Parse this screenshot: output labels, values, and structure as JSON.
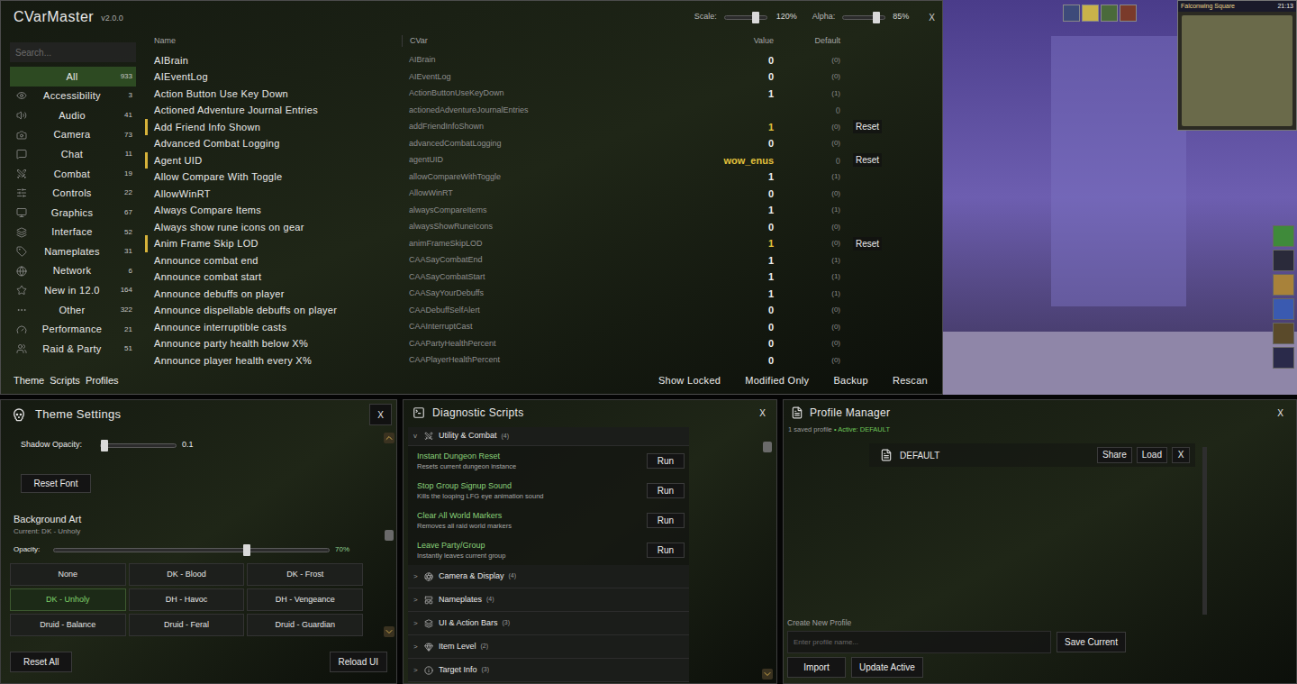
{
  "main": {
    "title": "CVarMaster",
    "version": "v2.0.0",
    "scale": {
      "label": "Scale:",
      "level": 0.75,
      "reading": "120%"
    },
    "alpha": {
      "label": "Alpha:",
      "level": 0.8,
      "reading": "85%"
    },
    "close": "X",
    "search": {
      "placeholder": "Search..."
    },
    "categories": [
      {
        "label": "All",
        "count": "933",
        "selected": true
      },
      {
        "label": "Accessibility",
        "count": "3",
        "selected": false
      },
      {
        "label": "Audio",
        "count": "41",
        "selected": false
      },
      {
        "label": "Camera",
        "count": "73",
        "selected": false
      },
      {
        "label": "Chat",
        "count": "11",
        "selected": false
      },
      {
        "label": "Combat",
        "count": "19",
        "selected": false
      },
      {
        "label": "Controls",
        "count": "22",
        "selected": false
      },
      {
        "label": "Graphics",
        "count": "67",
        "selected": false
      },
      {
        "label": "Interface",
        "count": "52",
        "selected": false
      },
      {
        "label": "Nameplates",
        "count": "31",
        "selected": false
      },
      {
        "label": "Network",
        "count": "6",
        "selected": false
      },
      {
        "label": "New in 12.0",
        "count": "164",
        "selected": false
      },
      {
        "label": "Other",
        "count": "322",
        "selected": false
      },
      {
        "label": "Performance",
        "count": "21",
        "selected": false
      },
      {
        "label": "Raid & Party",
        "count": "51",
        "selected": false
      }
    ],
    "columns": [
      "Name",
      "CVar",
      "Value",
      "Default"
    ],
    "rows": [
      {
        "name": "AIBrain",
        "cvar": "AIBrain",
        "value": "0",
        "default": "(0)",
        "modified": false,
        "reset": ""
      },
      {
        "name": "AIEventLog",
        "cvar": "AIEventLog",
        "value": "0",
        "default": "(0)",
        "modified": false,
        "reset": ""
      },
      {
        "name": "Action Button Use Key Down",
        "cvar": "ActionButtonUseKeyDown",
        "value": "1",
        "default": "(1)",
        "modified": false,
        "reset": ""
      },
      {
        "name": "Actioned Adventure Journal Entries",
        "cvar": "actionedAdventureJournalEntries",
        "value": "",
        "default": "()",
        "modified": false,
        "reset": ""
      },
      {
        "name": "Add Friend Info Shown",
        "cvar": "addFriendInfoShown",
        "value": "1",
        "default": "(0)",
        "modified": true,
        "reset": "Reset"
      },
      {
        "name": "Advanced Combat Logging",
        "cvar": "advancedCombatLogging",
        "value": "0",
        "default": "(0)",
        "modified": false,
        "reset": ""
      },
      {
        "name": "Agent UID",
        "cvar": "agentUID",
        "value": "wow_enus",
        "default": "()",
        "modified": true,
        "reset": "Reset"
      },
      {
        "name": "Allow Compare With Toggle",
        "cvar": "allowCompareWithToggle",
        "value": "1",
        "default": "(1)",
        "modified": false,
        "reset": ""
      },
      {
        "name": "AllowWinRT",
        "cvar": "AllowWinRT",
        "value": "0",
        "default": "(0)",
        "modified": false,
        "reset": ""
      },
      {
        "name": "Always Compare Items",
        "cvar": "alwaysCompareItems",
        "value": "1",
        "default": "(1)",
        "modified": false,
        "reset": ""
      },
      {
        "name": "Always show rune icons on gear",
        "cvar": "alwaysShowRuneIcons",
        "value": "0",
        "default": "(0)",
        "modified": false,
        "reset": ""
      },
      {
        "name": "Anim Frame Skip LOD",
        "cvar": "animFrameSkipLOD",
        "value": "1",
        "default": "(0)",
        "modified": true,
        "reset": "Reset"
      },
      {
        "name": "Announce combat end",
        "cvar": "CAASayCombatEnd",
        "value": "1",
        "default": "(1)",
        "modified": false,
        "reset": ""
      },
      {
        "name": "Announce combat start",
        "cvar": "CAASayCombatStart",
        "value": "1",
        "default": "(1)",
        "modified": false,
        "reset": ""
      },
      {
        "name": "Announce debuffs on player",
        "cvar": "CAASayYourDebuffs",
        "value": "1",
        "default": "(1)",
        "modified": false,
        "reset": ""
      },
      {
        "name": "Announce dispellable debuffs on player",
        "cvar": "CAADebuffSelfAlert",
        "value": "0",
        "default": "(0)",
        "modified": false,
        "reset": ""
      },
      {
        "name": "Announce interruptible casts",
        "cvar": "CAAInterruptCast",
        "value": "0",
        "default": "(0)",
        "modified": false,
        "reset": ""
      },
      {
        "name": "Announce party health below X%",
        "cvar": "CAAPartyHealthPercent",
        "value": "0",
        "default": "(0)",
        "modified": false,
        "reset": ""
      },
      {
        "name": "Announce player health every X%",
        "cvar": "CAAPlayerHealthPercent",
        "value": "0",
        "default": "(0)",
        "modified": false,
        "reset": ""
      }
    ],
    "footer_left": [
      "Theme",
      "Scripts",
      "Profiles"
    ],
    "footer_right": [
      "Show Locked",
      "Modified Only",
      "Backup",
      "Rescan"
    ]
  },
  "game": {
    "zone": "Falconwing Square",
    "time": "21:13"
  },
  "theme": {
    "title": "Theme Settings",
    "close": "X",
    "shadow": {
      "label": "Shadow Opacity:",
      "level": 0.05,
      "reading": "0.1"
    },
    "reset_font": "Reset Font",
    "background": {
      "title": "Background Art",
      "current": "Current: DK - Unholy",
      "opacity": {
        "label": "Opacity:",
        "level": 0.7,
        "reading": "70%"
      },
      "options": [
        {
          "label": "None",
          "selected": false
        },
        {
          "label": "DK - Blood",
          "selected": false
        },
        {
          "label": "DK - Frost",
          "selected": false
        },
        {
          "label": "DK - Unholy",
          "selected": true
        },
        {
          "label": "DH - Havoc",
          "selected": false
        },
        {
          "label": "DH - Vengeance",
          "selected": false
        },
        {
          "label": "Druid - Balance",
          "selected": false
        },
        {
          "label": "Druid - Feral",
          "selected": false
        },
        {
          "label": "Druid - Guardian",
          "selected": false
        }
      ]
    },
    "scroll_level": 0.5,
    "buttons": [
      "Reset All",
      "Reload UI"
    ]
  },
  "scripts": {
    "title": "Diagnostic Scripts",
    "close": "X",
    "scroll_level": 0,
    "sections": [
      {
        "chevron": "v",
        "label": "Utility & Combat",
        "count": "(4)",
        "expanded": true,
        "scripts": [
          {
            "name": "Instant Dungeon Reset",
            "description": "Resets current dungeon instance",
            "action": "Run"
          },
          {
            "name": "Stop Group Signup Sound",
            "description": "Kills the looping LFG eye animation sound",
            "action": "Run"
          },
          {
            "name": "Clear All World Markers",
            "description": "Removes all raid world markers",
            "action": "Run"
          },
          {
            "name": "Leave Party/Group",
            "description": "Instantly leaves current group",
            "action": "Run"
          }
        ]
      },
      {
        "chevron": ">",
        "label": "Camera & Display",
        "count": "(4)",
        "expanded": false,
        "scripts": []
      },
      {
        "chevron": ">",
        "label": "Nameplates",
        "count": "(4)",
        "expanded": false,
        "scripts": []
      },
      {
        "chevron": ">",
        "label": "UI & Action Bars",
        "count": "(3)",
        "expanded": false,
        "scripts": []
      },
      {
        "chevron": ">",
        "label": "Item Level",
        "count": "(2)",
        "expanded": false,
        "scripts": []
      },
      {
        "chevron": ">",
        "label": "Target Info",
        "count": "(3)",
        "expanded": false,
        "scripts": []
      }
    ]
  },
  "profiles": {
    "title": "Profile Manager",
    "close": "X",
    "summary": "1 saved profile",
    "active": "• Active: DEFAULT",
    "items": [
      {
        "name": "DEFAULT",
        "actions": [
          "Share",
          "Load"
        ],
        "delete": "X"
      }
    ],
    "create": {
      "label": "Create New Profile",
      "placeholder": "Enter profile name...",
      "save": "Save Current"
    },
    "buttons": [
      "Import",
      "Update Active"
    ]
  }
}
